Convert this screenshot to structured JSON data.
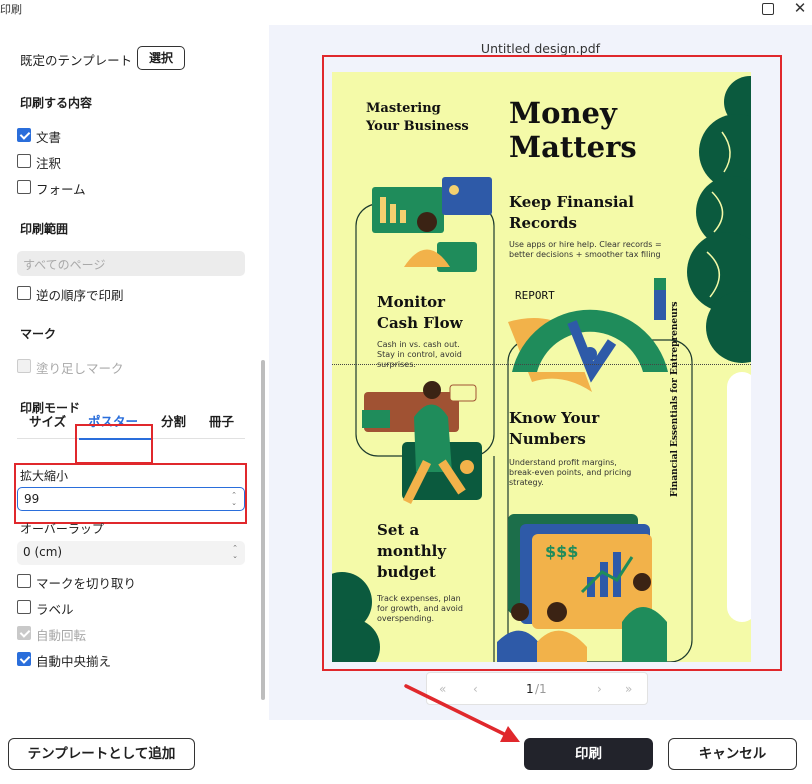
{
  "window": {
    "title": "印刷"
  },
  "template": {
    "label": "既定のテンプレート",
    "select_button": "選択"
  },
  "content_section": {
    "title": "印刷する内容",
    "items": [
      {
        "label": "文書",
        "checked": true
      },
      {
        "label": "注釈",
        "checked": false
      },
      {
        "label": "フォーム",
        "checked": false
      }
    ]
  },
  "range_section": {
    "title": "印刷範囲",
    "select_placeholder": "すべてのページ",
    "reverse_label": "逆の順序で印刷"
  },
  "mark_section": {
    "title": "マーク",
    "bleed_label": "塗り足しマーク"
  },
  "mode_section": {
    "title": "印刷モード",
    "tabs": [
      "サイズ",
      "ポスター",
      "分割",
      "冊子"
    ],
    "active_tab": "ポスター",
    "scale_label": "拡大縮小",
    "scale_value": "99",
    "overlap_label": "オーバーラップ",
    "overlap_value": "0 (cm)",
    "options": [
      {
        "label": "マークを切り取り",
        "checked": false,
        "disabled": false
      },
      {
        "label": "ラベル",
        "checked": false,
        "disabled": false
      },
      {
        "label": "自動回転",
        "checked": true,
        "disabled": true
      },
      {
        "label": "自動中央揃え",
        "checked": true,
        "disabled": false
      }
    ]
  },
  "preview": {
    "filename": "Untitled design.pdf",
    "page_current": "1",
    "page_total": "/1",
    "poster": {
      "mastering": "Mastering\nYour Business",
      "money": "Money\nMatters",
      "keep_title": "Keep Finansial\nRecords",
      "keep_text": "Use apps or hire help. Clear records =\nbetter decisions + smoother tax filing",
      "report": "REPORT",
      "monitor_title": "Monitor\nCash Flow",
      "monitor_text": "Cash in vs. cash out.\nStay in control, avoid\nsurprises.",
      "know_title": "Know Your\nNumbers",
      "know_text": "Understand profit margins,\nbreak-even points, and pricing\nstrategy.",
      "set_title": "Set a\nmonthly\nbudget",
      "set_text": "Track expenses, plan\nfor growth, and avoid\noverspending.",
      "side_text": "Financial Essentials for Entrepreneurs",
      "dollars": "$$$"
    }
  },
  "footer": {
    "add_template": "テンプレートとして追加",
    "print": "印刷",
    "cancel": "キャンセル"
  },
  "colors": {
    "accent": "#2a6edb",
    "highlight": "#e0282c",
    "paper": "#f4faa8",
    "dark_green": "#0b5a3e",
    "print_button": "#22232b"
  }
}
